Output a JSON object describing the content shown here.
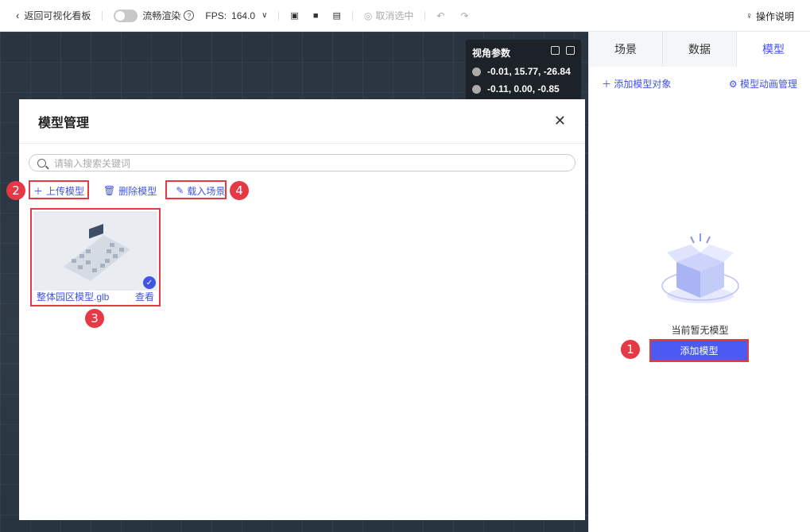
{
  "toolbar": {
    "back_label": "返回可视化看板",
    "smooth_render_label": "流畅渲染",
    "fps_label": "FPS:",
    "fps_value": "164.0",
    "cancel_select_label": "取消选中",
    "help_label": "操作说明"
  },
  "view_params": {
    "title": "视角参数",
    "camera_position": "-0.01, 15.77, -26.84",
    "target_position": "-0.11, 0.00, -0.85"
  },
  "right_panel": {
    "tabs": [
      {
        "label": "场景"
      },
      {
        "label": "数据"
      },
      {
        "label": "模型"
      }
    ],
    "add_object_label": "添加模型对象",
    "animation_manage_label": "模型动画管理",
    "empty_text": "当前暂无模型",
    "add_model_button": "添加模型"
  },
  "modal": {
    "title": "模型管理",
    "search_placeholder": "请输入搜索关键词",
    "upload_label": "上传模型",
    "delete_label": "删除模型",
    "load_scene_label": "载入场景",
    "cards": [
      {
        "name": "整体园区模型.glb",
        "view_label": "查看"
      }
    ]
  },
  "markers": [
    "1",
    "2",
    "3",
    "4"
  ],
  "colors": {
    "accent": "#4154e2",
    "highlight": "#e63946",
    "canvas_bg": "#2f3b47"
  }
}
